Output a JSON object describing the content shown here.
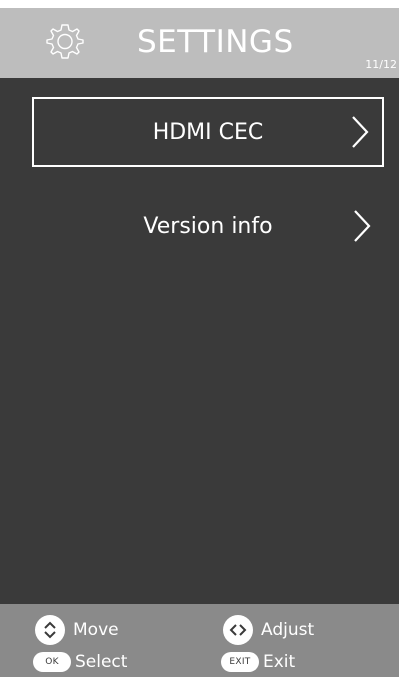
{
  "header": {
    "title": "SETTINGS",
    "page_indicator": "11/12",
    "icon": "gear-icon"
  },
  "menu": {
    "items": [
      {
        "label": "HDMI CEC",
        "selected": true
      },
      {
        "label": "Version info",
        "selected": false
      }
    ]
  },
  "footer": {
    "move_label": "Move",
    "adjust_label": "Adjust",
    "select_label": "Select",
    "exit_label": "Exit",
    "ok_key": "OK",
    "exit_key": "EXIT"
  }
}
